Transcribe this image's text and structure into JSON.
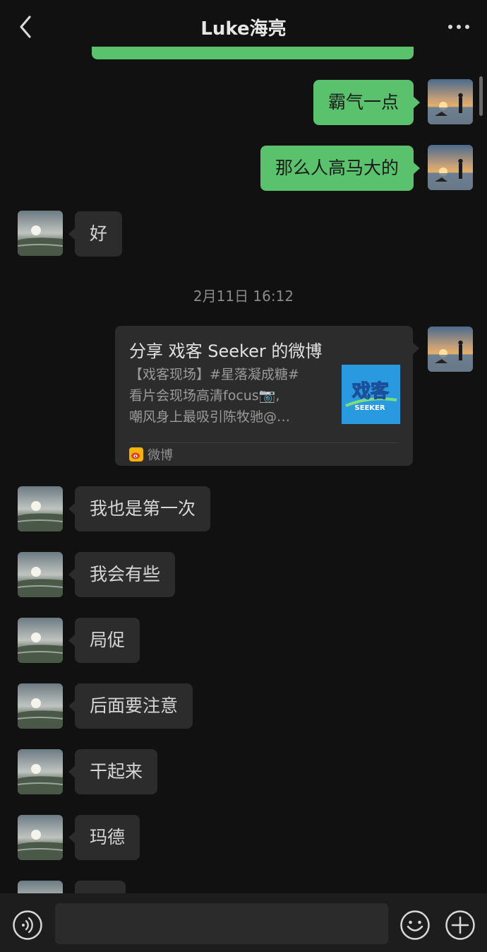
{
  "header": {
    "title": "Luke海亮",
    "back_icon": "chevron-left-icon",
    "more_icon": "more-dots-icon"
  },
  "colors": {
    "background": "#111111",
    "my_bubble": "#5ac26d",
    "their_bubble": "#2c2c2c",
    "timestamp": "#8a8a8a"
  },
  "messages_before": [
    {
      "sender": "me",
      "text": "霸气一点"
    },
    {
      "sender": "me",
      "text": "那么人高马大的"
    },
    {
      "sender": "them",
      "text": "好"
    }
  ],
  "timestamp": "2月11日 16:12",
  "share_card": {
    "sender": "me",
    "title": "分享 戏客 Seeker 的微博",
    "desc_lines": [
      "【戏客现场】#星落凝成糖#",
      " 看片会现场高清focus📷,",
      "嘲风身上最吸引陈牧驰@…"
    ],
    "thumbnail_text": "戏客",
    "thumbnail_sub": "SEEKER",
    "source": "微博",
    "source_icon": "weibo-icon"
  },
  "messages_after": [
    {
      "sender": "them",
      "text": "我也是第一次"
    },
    {
      "sender": "them",
      "text": "我会有些"
    },
    {
      "sender": "them",
      "text": "局促"
    },
    {
      "sender": "them",
      "text": "后面要注意"
    },
    {
      "sender": "them",
      "text": "干起来"
    },
    {
      "sender": "them",
      "text": "玛德"
    }
  ],
  "input_bar": {
    "voice_icon": "voice-icon",
    "emoji_icon": "emoji-icon",
    "plus_icon": "plus-icon",
    "input_value": ""
  }
}
